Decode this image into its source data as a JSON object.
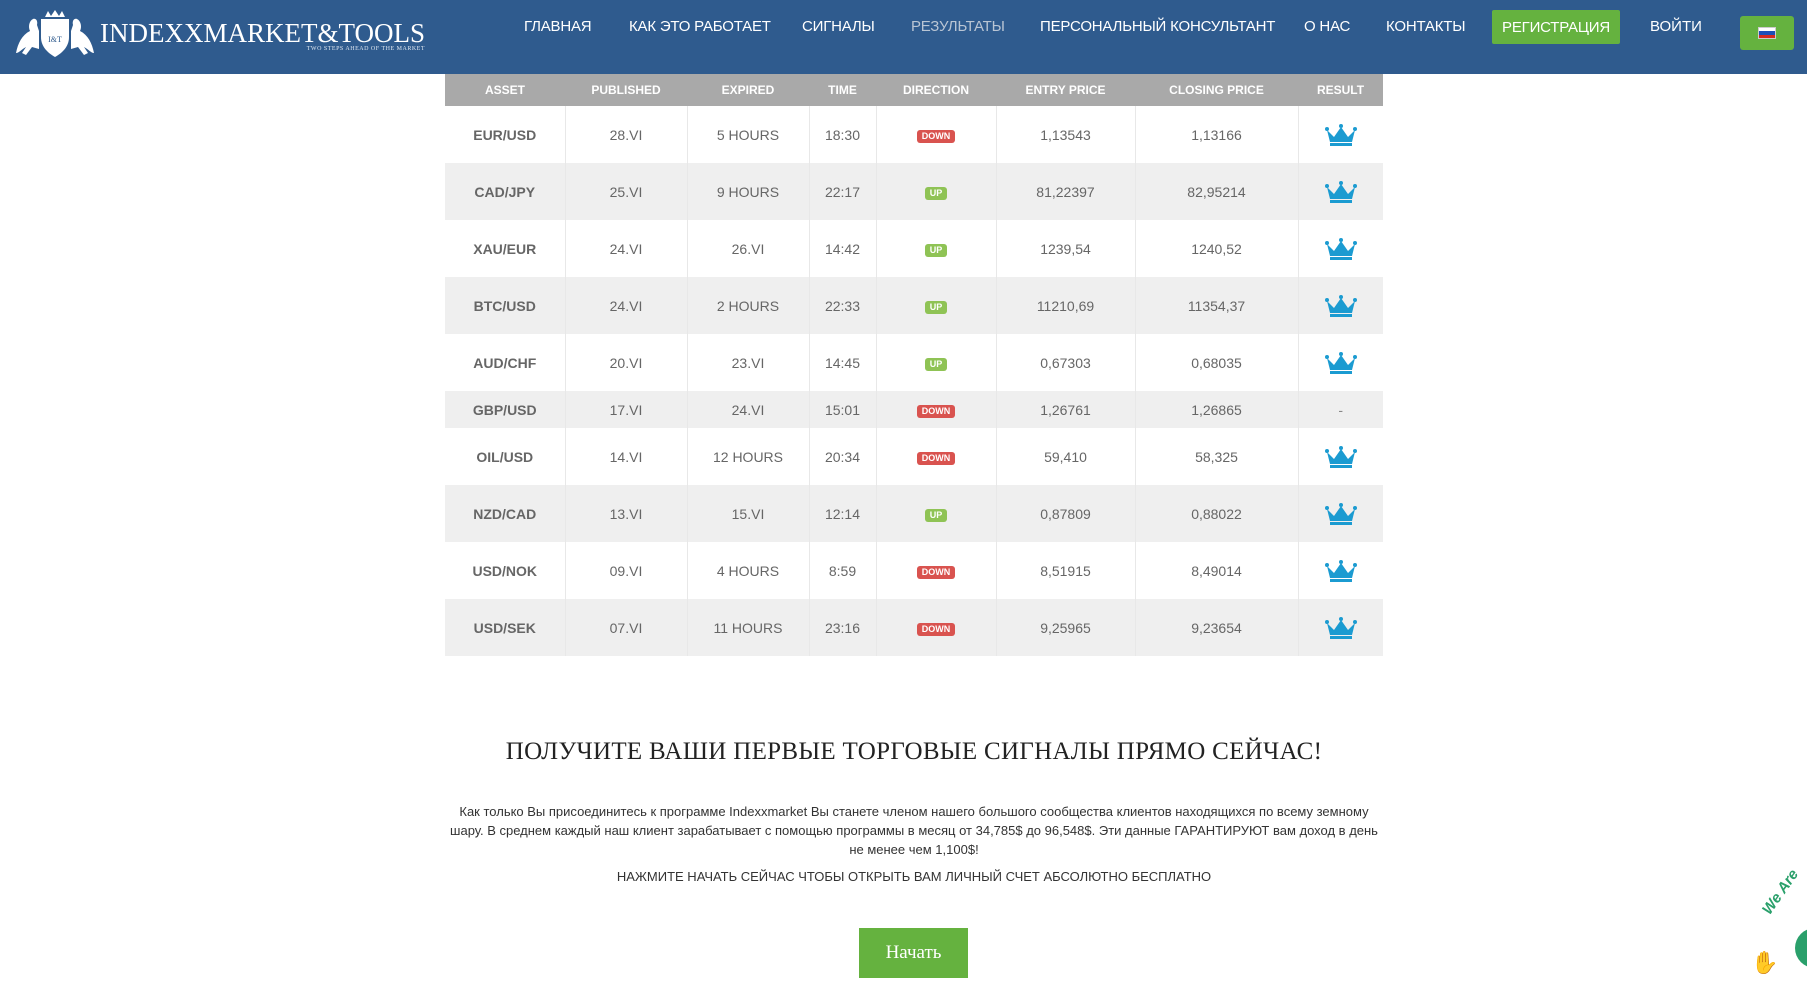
{
  "header": {
    "logo_name": "INDEXXMARKET&TOOLS",
    "logo_tagline": "TWO STEPS AHEAD OF THE MARKET",
    "logo_emblem_text": "I&T",
    "nav": [
      {
        "label": "ГЛАВНАЯ"
      },
      {
        "label": "КАК ЭТО РАБОТАЕТ"
      },
      {
        "label": "СИГНАЛЫ"
      },
      {
        "label": "РЕЗУЛЬТАТЫ"
      },
      {
        "label": "ПЕРСОНАЛЬНЫЙ КОНСУЛЬТАНТ"
      },
      {
        "label": "О НАС"
      },
      {
        "label": "КОНТАКТЫ"
      }
    ],
    "register_label": "РЕГИСТРАЦИЯ",
    "login_label": "ВОЙТИ",
    "language_flag": "flag-ru-icon"
  },
  "table": {
    "columns": [
      "ASSET",
      "PUBLISHED",
      "EXPIRED",
      "TIME",
      "DIRECTION",
      "ENTRY PRICE",
      "CLOSING PRICE",
      "RESULT"
    ],
    "rows": [
      {
        "asset": "EUR/USD",
        "published": "28.VI",
        "expired": "5 HOURS",
        "time": "18:30",
        "direction": "DOWN",
        "entry": "1,13543",
        "closing": "1,13166",
        "result": "crown"
      },
      {
        "asset": "CAD/JPY",
        "published": "25.VI",
        "expired": "9 HOURS",
        "time": "22:17",
        "direction": "UP",
        "entry": "81,22397",
        "closing": "82,95214",
        "result": "crown"
      },
      {
        "asset": "XAU/EUR",
        "published": "24.VI",
        "expired": "26.VI",
        "time": "14:42",
        "direction": "UP",
        "entry": "1239,54",
        "closing": "1240,52",
        "result": "crown"
      },
      {
        "asset": "BTC/USD",
        "published": "24.VI",
        "expired": "2 HOURS",
        "time": "22:33",
        "direction": "UP",
        "entry": "11210,69",
        "closing": "11354,37",
        "result": "crown"
      },
      {
        "asset": "AUD/CHF",
        "published": "20.VI",
        "expired": "23.VI",
        "time": "14:45",
        "direction": "UP",
        "entry": "0,67303",
        "closing": "0,68035",
        "result": "crown"
      },
      {
        "asset": "GBP/USD",
        "published": "17.VI",
        "expired": "24.VI",
        "time": "15:01",
        "direction": "DOWN",
        "entry": "1,26761",
        "closing": "1,26865",
        "result": "-"
      },
      {
        "asset": "OIL/USD",
        "published": "14.VI",
        "expired": "12 HOURS",
        "time": "20:34",
        "direction": "DOWN",
        "entry": "59,410",
        "closing": "58,325",
        "result": "crown"
      },
      {
        "asset": "NZD/CAD",
        "published": "13.VI",
        "expired": "15.VI",
        "time": "12:14",
        "direction": "UP",
        "entry": "0,87809",
        "closing": "0,88022",
        "result": "crown"
      },
      {
        "asset": "USD/NOK",
        "published": "09.VI",
        "expired": "4 HOURS",
        "time": "8:59",
        "direction": "DOWN",
        "entry": "8,51915",
        "closing": "8,49014",
        "result": "crown"
      },
      {
        "asset": "USD/SEK",
        "published": "07.VI",
        "expired": "11 HOURS",
        "time": "23:16",
        "direction": "DOWN",
        "entry": "9,25965",
        "closing": "9,23654",
        "result": "crown"
      }
    ]
  },
  "cta": {
    "title": "ПОЛУЧИТЕ ВАШИ ПЕРВЫЕ ТОРГОВЫЕ СИГНАЛЫ ПРЯМО СЕЙЧАС!",
    "text": "Как только Вы присоединитесь к программе Indexxmarket Вы станете членом нашего большого сообщества клиентов находящихся по всему земному шару. В среднем каждый наш клиент зарабатывает с помощью программы в месяц от 34,785$ до 96,548$. Эти данные ГАРАНТИРУЮТ вам доход в день не менее чем 1,100$!",
    "sub": "НАЖМИТЕ НАЧАТЬ СЕЙЧАС ЧТОБЫ ОТКРЫТЬ ВАМ ЛИЧНЫЙ СЧЕТ АБСОЛЮТНО БЕСПЛАТНО",
    "button": "Начать"
  },
  "chat": {
    "label": "We Are"
  },
  "colors": {
    "header_bg": "#2f5b8e",
    "accent_green": "#65b23f",
    "down_red": "#d9534f",
    "up_green": "#8fc355",
    "crown_blue": "#1b9bd1",
    "table_header_bg": "#a9a9a9"
  }
}
